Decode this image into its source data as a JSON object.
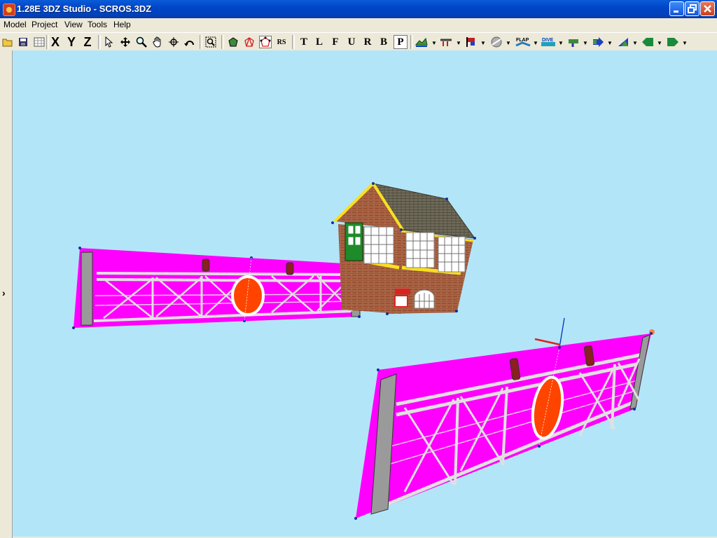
{
  "window": {
    "title": "1.28E 3DZ Studio - SCROS.3DZ"
  },
  "menu": [
    "Model",
    "Project",
    "View",
    "Tools",
    "Help"
  ],
  "toolbar": {
    "view_letters": [
      "T",
      "L",
      "F",
      "U",
      "R",
      "B",
      "P"
    ],
    "axis_letters": [
      "X",
      "Y",
      "Z"
    ],
    "rs_label": "RS",
    "flap_label": "FLAP",
    "dive_label": "DIVE"
  },
  "colors": {
    "viewport_bg": "#B3E5F8",
    "gate_panel": "#FF00FF",
    "titlebar": "#0A5CD8",
    "chrome": "#ECE9D8"
  },
  "icons": [
    "open-icon",
    "save-icon",
    "grid-icon",
    "select-arrow-icon",
    "move-icon",
    "zoom-icon",
    "pan-hand-icon",
    "rotate-icon",
    "undo-icon",
    "zoom-fit-icon",
    "solid-icon",
    "wire-icon",
    "point-icon"
  ]
}
